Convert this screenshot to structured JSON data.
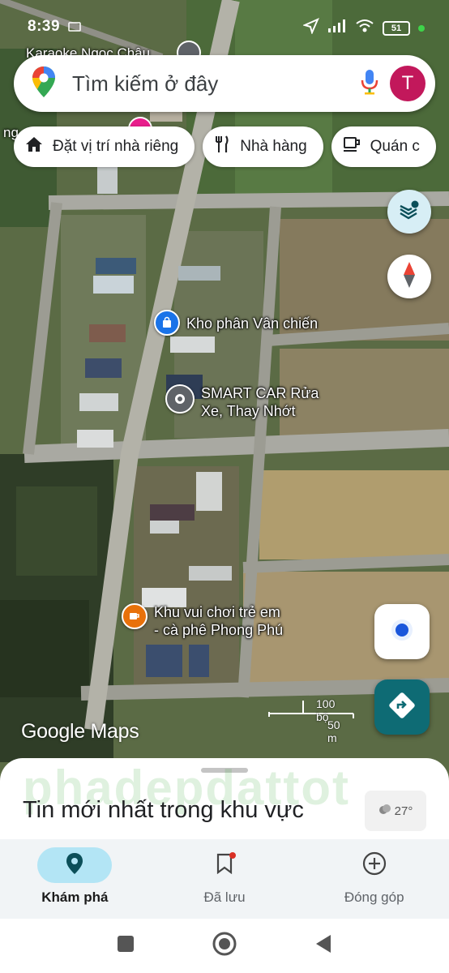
{
  "status_bar": {
    "time": "8:39",
    "battery": "51"
  },
  "search": {
    "placeholder": "Tìm kiếm ở đây",
    "avatar_letter": "T"
  },
  "chips": [
    {
      "label": "Đặt vị trí nhà riêng",
      "icon": "home-icon"
    },
    {
      "label": "Nhà hàng",
      "icon": "restaurant-icon"
    },
    {
      "label": "Quán c",
      "icon": "cafe-icon"
    }
  ],
  "map": {
    "top_place": "Karaoke Ngọc Châu",
    "pois": [
      {
        "name": "Kho phân Vân chiến",
        "icon": "shopping-bag-icon",
        "color": "#1a73e8"
      },
      {
        "name_line1": "SMART CAR Rửa",
        "name_line2": "Xe, Thay Nhớt",
        "icon": "pin-icon",
        "color": "#5f6368"
      },
      {
        "name_line1": "Khu vui chơi trẻ em",
        "name_line2": "- cà phê Phong Phú",
        "icon": "coffee-icon",
        "color": "#e8710a"
      }
    ],
    "scale_feet": "100 bộ",
    "scale_meters": "50 m",
    "logo": "Google Maps"
  },
  "sheet": {
    "title": "Tin mới nhất trong khu vực",
    "weather_temp": "27°",
    "watermark": "phadepdattot"
  },
  "nav": [
    {
      "label": "Khám phá",
      "icon": "explore-pin-icon",
      "active": true
    },
    {
      "label": "Đã lưu",
      "icon": "bookmark-icon",
      "active": false
    },
    {
      "label": "Đóng góp",
      "icon": "add-circle-icon",
      "active": false
    }
  ],
  "colors": {
    "accent": "#0e6b74",
    "avatar": "#c2185b",
    "active_pill": "#b3e5f5"
  }
}
